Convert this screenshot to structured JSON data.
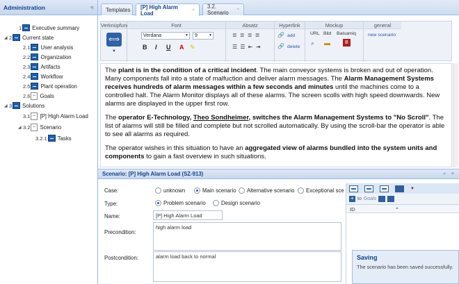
{
  "sidebar": {
    "title": "Administration",
    "collapse": "«",
    "items": [
      {
        "num": "1",
        "label": "Executive summary",
        "arrow": "",
        "icon": "section-icon"
      },
      {
        "num": "2",
        "label": "Current state",
        "arrow": "◢",
        "icon": "section-icon"
      },
      {
        "num": "2.1",
        "label": "User analysis",
        "arrow": "",
        "icon": "section-icon"
      },
      {
        "num": "2.2",
        "label": "Organization",
        "arrow": "",
        "icon": "section-icon"
      },
      {
        "num": "2.3",
        "label": "Artifacts",
        "arrow": "",
        "icon": "section-icon"
      },
      {
        "num": "2.4",
        "label": "Workflow",
        "arrow": "",
        "icon": "section-icon"
      },
      {
        "num": "2.5",
        "label": "Plant operation",
        "arrow": "",
        "icon": "section-icon"
      },
      {
        "num": "2.6",
        "label": "Goals",
        "arrow": "",
        "icon": "document-icon"
      },
      {
        "num": "3",
        "label": "Solutions",
        "arrow": "◢",
        "icon": "section-icon"
      },
      {
        "num": "3.1",
        "label": "[P] High Alarm Load",
        "arrow": "",
        "icon": "document-icon"
      },
      {
        "num": "3.2",
        "label": "Scenario",
        "arrow": "◢",
        "icon": "document-icon"
      },
      {
        "num": "3.2.1",
        "label": "Tasks",
        "arrow": "",
        "icon": "section-icon"
      }
    ]
  },
  "tabs": [
    {
      "label": "Templates",
      "close": ""
    },
    {
      "label": "[P] High Alarm Load",
      "close": "×"
    },
    {
      "label": "3.2. Scenario",
      "close": "×"
    }
  ],
  "ribbon": {
    "groups": {
      "link": "Verknüpfung",
      "font": "Font",
      "paragraph": "Absatz",
      "hyperlink": "Hyperlink",
      "mockup": "Mockup",
      "general": "general"
    },
    "font_name": "Verdana",
    "font_size": "9",
    "format_buttons": {
      "bold": "B",
      "italic": "I",
      "underline": "U",
      "color": "A"
    },
    "hyperlink_add": "add",
    "hyperlink_delete": "delete",
    "mockup_url": "URL",
    "mockup_image": "Bild",
    "mockup_balsamiq": "Balsamiq",
    "new_scenario": "new scenario"
  },
  "editor": {
    "paragraphs": [
      [
        {
          "t": "The ",
          "b": false
        },
        {
          "t": "plant is in the condition of a critical incident",
          "b": true
        },
        {
          "t": ". The main conveyor systems is broken and out of operation. Many components fall into a state of malfuction and deliver alarm messages. The ",
          "b": false
        },
        {
          "t": "Alarm Management Systems receives hundreds of alarm messages within a few seconds and minutes",
          "b": true
        },
        {
          "t": " until the machines come to a controlled halt. The Alarm Monitor displays all of these alarms. The screen scolls with high speed downwards. New alarms are displayed in the upper first row.",
          "b": false
        }
      ],
      [
        {
          "t": "The ",
          "b": false
        },
        {
          "t": "operator E-Technology, ",
          "b": true
        },
        {
          "t": "Theo Sondheimer",
          "b": true,
          "u": true
        },
        {
          "t": ", switches the  Alarm Management Systems to \"No Scroll\"",
          "b": true
        },
        {
          "t": ". The list of alarms will still be filled and complete but not scrolled automatically. By using the scroll-bar the operator is able to see all alarms as required.",
          "b": false
        }
      ],
      [
        {
          "t": "The operator wishes in this situation to have an ",
          "b": false
        },
        {
          "t": "aggregated view of alarms bundled into the system units and components",
          "b": true
        },
        {
          "t": " to gain a fast overview in such situations.",
          "b": false
        }
      ]
    ]
  },
  "scenario": {
    "title": "Scenario: [P] High Alarm Load (SZ-913)",
    "tools": "« ≡",
    "case_label": "Case:",
    "case_options": [
      {
        "label": "unknown",
        "checked": false
      },
      {
        "label": "Main scenario",
        "checked": true
      },
      {
        "label": "Alternative scenario",
        "checked": false
      },
      {
        "label": "Exceptional sce",
        "checked": false
      }
    ],
    "type_label": "Type:",
    "type_options": [
      {
        "label": "Problem scenario",
        "checked": true
      },
      {
        "label": "Design scenario",
        "checked": false
      }
    ],
    "name_label": "Name:",
    "name_value": "[P] High Alarm Load",
    "precondition_label": "Precondition:",
    "precondition_value": "high alarm load",
    "postcondition_label": "Postcondition:",
    "postcondition_value": "alarm load back to normal"
  },
  "tasks_panel": {
    "dropdown": "▼",
    "action_to": "to",
    "action_goals": "Goals",
    "grid_id": "ID",
    "grid_sort": "▲"
  },
  "toast": {
    "title": "Saving",
    "message": "The scenario has been saved successfully."
  }
}
